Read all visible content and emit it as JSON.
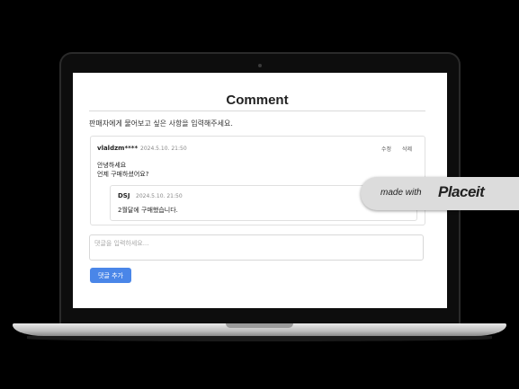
{
  "page": {
    "title": "Comment",
    "prompt": "판매자에게 물어보고 싶은 사항을 입력해주세요."
  },
  "comment": {
    "author": "vlaldzm****",
    "date": "2024.5.10. 21:50",
    "edit_label": "수정",
    "delete_label": "삭제",
    "line1": "안녕하세요",
    "line2": "언제 구매하셨어요?",
    "reply": {
      "author": "DSJ",
      "date": "2024.5.10. 21:50",
      "text": "2월달에 구매했습니다."
    }
  },
  "reply_form": {
    "placeholder": "댓글을 입력하세요...",
    "value": "",
    "button_label": "댓글 추가"
  },
  "watermark": {
    "made_with": "made with",
    "brand": "Placeit"
  },
  "colors": {
    "accent": "#4a86e8",
    "background": "#000000",
    "screen": "#ffffff"
  }
}
